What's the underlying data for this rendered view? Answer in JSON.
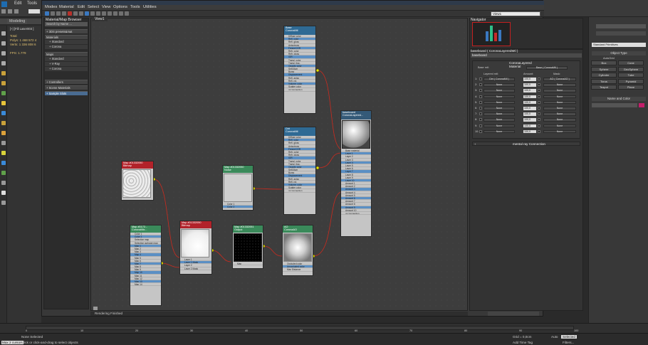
{
  "max": {
    "menus": [
      "Edit",
      "Tools"
    ],
    "tabs": [
      "Modeling"
    ],
    "scene": {
      "layer": "[+] [Fill Laser003 ]",
      "total_label": "Total",
      "polys": "Polys: 1 468 572 4",
      "verts": "Verts: 1 336 808 6",
      "fps": "FPS: 1.779"
    }
  },
  "slate": {
    "menus": [
      "Modes",
      "Material",
      "Edit",
      "Select",
      "View",
      "Options",
      "Tools",
      "Utilities"
    ],
    "view_selector": "View1",
    "browser": {
      "title": "Material/Map Browser",
      "search_placeholder": "Search by Name ...",
      "groups": [
        "+ 3DS presets&mat",
        "Materials",
        "+ Standard",
        "+ Corona",
        "Maps",
        "+ Standard",
        "+ V-Ray",
        "+ Corona",
        "+ Controllers",
        "+ Scene Materials",
        "+ Sample Slots"
      ],
      "selected": "+ Sample Slots"
    },
    "view_tab": "View1",
    "status": "Rendering Finished",
    "nodes": {
      "base": {
        "title": "Base\nCoronaMtl",
        "slots": [
          "Diffuse color",
          "Refl. color",
          "Refl. gloss",
          "Anisotropy",
          "Fresnel IOR",
          "Refr. color",
          "Refr. gloss",
          "IOR",
          "Transl. color",
          "Transl. frac.",
          "Opacity color",
          "Self-illum",
          "Bump",
          "Displacement",
          "Refl. aniso",
          "Refl. rot.",
          "Volume: color",
          "Scatter color"
        ],
        "footer": "mr Connection"
      },
      "dirt": {
        "title": "Dirt\nCoronaMtl",
        "slots": [
          "Diffuse color",
          "Refl. color",
          "Refl. gloss",
          "Anisotropy",
          "Fresnel IOR",
          "Refr. color",
          "Refr. gloss",
          "IOR",
          "Transl. color",
          "Transl. frac.",
          "Opacity color",
          "Self-illum",
          "Bump",
          "Displacement",
          "Refl. aniso",
          "Refl. rot.",
          "Volume: color",
          "Scatter color"
        ],
        "footer": "mr Connection"
      },
      "layered": {
        "title": "baseboard\nCoronaLayered...",
        "slots": [
          "Base material",
          "Layer 1",
          "Layer 2",
          "Layer 3",
          "Layer 4",
          "Layer 5",
          "Layer 6",
          "Layer 7",
          "Layer 8",
          "Layer 9",
          "Layer 10",
          "Amount 1",
          "Amount 2",
          "Amount 3",
          "Amount 4",
          "Amount 5",
          "Amount 6",
          "Amount 7",
          "Amount 8",
          "Amount 9",
          "Amount 10"
        ],
        "footer": "mr Connection"
      },
      "noise": {
        "title": "Map #01332050\nNoise",
        "slots": [
          "Color 1",
          "Color 2"
        ]
      },
      "red1": {
        "title": "Map #01332050\nBitmap",
        "slots": []
      },
      "red2": {
        "title": "Map #01332050\nBitmap",
        "slots": [
          "Layer 1",
          "Layer 1 Mask",
          "Layer 2",
          "Layer 2 Mask"
        ]
      },
      "falloff": {
        "title": "Map #0172...\nCoronaMix...",
        "slots": [
          "Color 1",
          "Color 2",
          "Selection map",
          "Selection average map",
          "Map 1",
          "Map 2",
          "Map 3",
          "Map 4",
          "Map 5",
          "Map 6",
          "Map 7",
          "Map 8",
          "Map 9",
          "Map 10",
          "Map 11",
          "Map 12",
          "Map 13",
          "Map 14"
        ]
      },
      "output": {
        "title": "Map #01332051\nOutput",
        "slots": [
          "Map"
        ]
      },
      "ao": {
        "title": "AO\nCoronaAO",
        "slots": [
          "Occluded color",
          "Unoccluded color",
          "Max Distance"
        ]
      }
    }
  },
  "navigator": {
    "title": "Navigator"
  },
  "params": {
    "title": "baseboard  ( CoronaLayeredMtl )",
    "name": "baseboard",
    "rollout": "CoronaLayered Material",
    "base_label": "Base mtl:",
    "base_value": "Base  ( CoronaMtl )",
    "headers": [
      "Layered mtl:",
      "Amount:",
      "Mask:"
    ],
    "rows": [
      {
        "i": "1:",
        "mtl": "Dirt  ( CoronaMtl )",
        "amt": "100,0",
        "mask": "AO  ( CoronaAO )"
      },
      {
        "i": "2:",
        "mtl": "None",
        "amt": "100,0",
        "mask": "None"
      },
      {
        "i": "3:",
        "mtl": "None",
        "amt": "100,0",
        "mask": "None"
      },
      {
        "i": "4:",
        "mtl": "None",
        "amt": "100,0",
        "mask": "None"
      },
      {
        "i": "5:",
        "mtl": "None",
        "amt": "100,0",
        "mask": "None"
      },
      {
        "i": "6:",
        "mtl": "None",
        "amt": "100,0",
        "mask": "None"
      },
      {
        "i": "7:",
        "mtl": "None",
        "amt": "100,0",
        "mask": "None"
      },
      {
        "i": "8:",
        "mtl": "None",
        "amt": "100,0",
        "mask": "None"
      },
      {
        "i": "9:",
        "mtl": "None",
        "amt": "100,0",
        "mask": "None"
      },
      {
        "i": "10:",
        "mtl": "None",
        "amt": "100,0",
        "mask": "None"
      }
    ],
    "mr_rollout": "mental ray Connection"
  },
  "command": {
    "dropdown": "Standard Primitives",
    "object_type": "Object Type",
    "autogrid": "AutoGrid",
    "buttons": [
      "Box",
      "Cone",
      "Sphere",
      "GeoSphere",
      "Cylinder",
      "Tube",
      "Torus",
      "Pyramid",
      "Teapot",
      "Plane"
    ],
    "name_color": "Name and Color",
    "color": "#c41e6a"
  },
  "timeline": {
    "ticks": [
      "0",
      "10",
      "20",
      "30",
      "40",
      "50",
      "60",
      "70",
      "80",
      "90",
      "100"
    ]
  },
  "statusbar": {
    "selected": "None Selected",
    "prompt": "Click or click-and-drag to select objects",
    "script": "Max 2 cursors",
    "grid": "Grid = 0,0cm",
    "auto": "Auto",
    "selected_dd": "Selected",
    "settime": "Add Time Tag",
    "filters": "Filters..."
  },
  "colors": {
    "accent": "#4a6c92",
    "wire": "#cc2a1e",
    "socket": "#e8e800"
  }
}
